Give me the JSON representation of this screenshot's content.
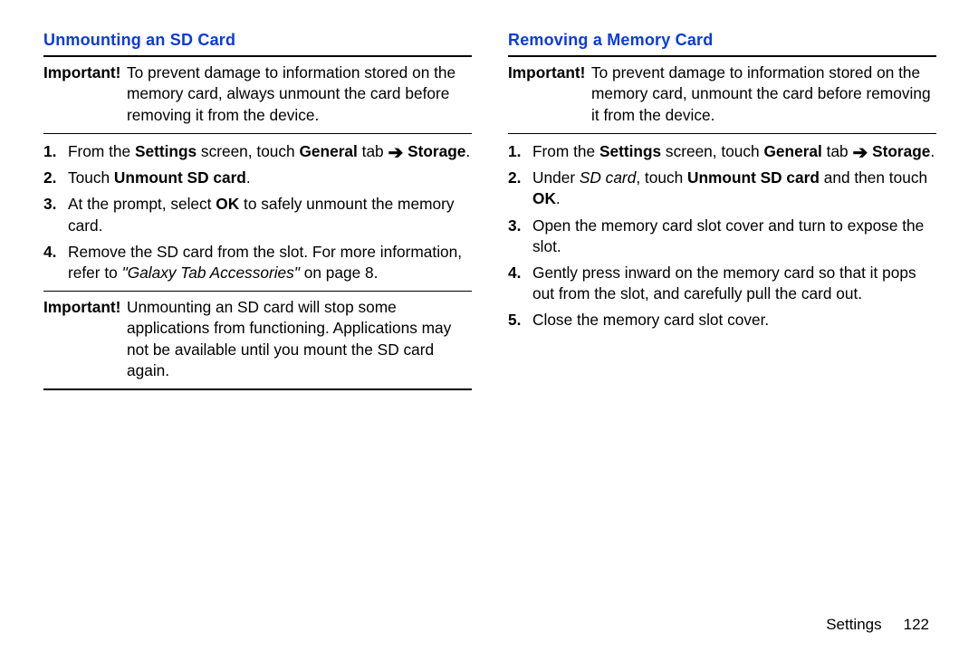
{
  "left": {
    "heading": "Unmounting an SD Card",
    "important1_label": "Important!",
    "important1_text": "To prevent damage to information stored on the memory card, always unmount the card before removing it from the device.",
    "step1_pre": "From the ",
    "step1_b1": "Settings",
    "step1_mid": " screen, touch ",
    "step1_b2": "General",
    "step1_post": " tab ",
    "step1_arrow": "➔",
    "step1_b3": "Storage",
    "step1_end": ".",
    "step2_pre": "Touch ",
    "step2_b1": "Unmount SD card",
    "step2_end": ".",
    "step3_pre": "At the prompt, select ",
    "step3_b1": "OK",
    "step3_post": " to safely unmount the memory card.",
    "step4_pre": "Remove the SD card from the slot. For more information, refer to ",
    "step4_it": "\"Galaxy Tab Accessories\"",
    "step4_post": " on page 8.",
    "important2_label": "Important!",
    "important2_text": "Unmounting an SD card will stop some applications from functioning. Applications may not be available until you mount the SD card again."
  },
  "right": {
    "heading": "Removing a Memory Card",
    "important1_label": "Important!",
    "important1_text": "To prevent damage to information stored on the memory card, unmount the card before removing it from the device.",
    "step1_pre": "From the ",
    "step1_b1": "Settings",
    "step1_mid": " screen, touch ",
    "step1_b2": "General",
    "step1_post": " tab ",
    "step1_arrow": "➔",
    "step1_b3": "Storage",
    "step1_end": ".",
    "step2_pre": "Under ",
    "step2_it": "SD card",
    "step2_mid": ", touch ",
    "step2_b1": "Unmount SD card",
    "step2_mid2": " and then touch ",
    "step2_b2": "OK",
    "step2_end": ".",
    "step3": "Open the memory card slot cover and turn to expose the slot.",
    "step4": "Gently press inward on the memory card so that it pops out from the slot, and carefully pull the card out.",
    "step5": "Close the memory card slot cover."
  },
  "footer": {
    "section": "Settings",
    "page": "122"
  }
}
